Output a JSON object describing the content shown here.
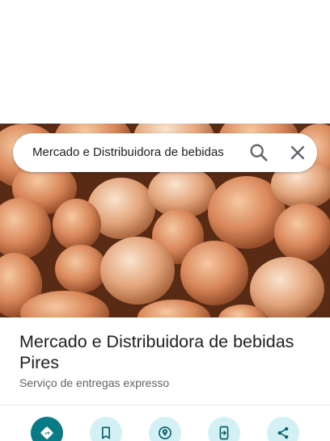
{
  "search": {
    "query": "Mercado e Distribuidora de bebidas",
    "search_icon": "search-icon",
    "close_icon": "close-icon"
  },
  "photo": {
    "subject": "onions"
  },
  "place": {
    "name": "Mercado e Distribuidora de bebidas Pires",
    "category": "Serviço de entregas expresso"
  },
  "actions": [
    {
      "icon": "directions-icon",
      "primary": true
    },
    {
      "icon": "bookmark-icon",
      "primary": false
    },
    {
      "icon": "nearby-icon",
      "primary": false
    },
    {
      "icon": "send-to-phone-icon",
      "primary": false
    },
    {
      "icon": "share-icon",
      "primary": false
    }
  ],
  "colors": {
    "primary_action": "#0b7a87",
    "secondary_action_bg": "#d3f1f5",
    "secondary_action_icon": "#0b5f6b",
    "title_text": "#202124",
    "subtitle_text": "#5f6368"
  }
}
